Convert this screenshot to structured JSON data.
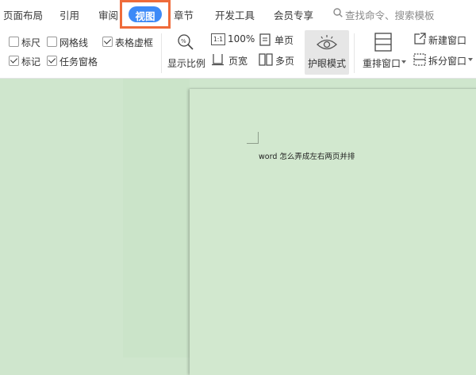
{
  "tabs": [
    {
      "label": "页面布局"
    },
    {
      "label": "引用"
    },
    {
      "label": "审阅"
    },
    {
      "label": "视图",
      "active": true
    },
    {
      "label": "章节"
    },
    {
      "label": "开发工具"
    },
    {
      "label": "会员专享"
    }
  ],
  "search": {
    "placeholder": "查找命令、搜索模板"
  },
  "checkboxes": [
    {
      "label": "标尺",
      "checked": false
    },
    {
      "label": "网格线",
      "checked": false
    },
    {
      "label": "表格虚框",
      "checked": true
    },
    {
      "label": "标记",
      "checked": true
    },
    {
      "label": "任务窗格",
      "checked": true
    }
  ],
  "ribbon": {
    "zoom_label": "显示比例",
    "hundred_label": "100%",
    "pagewidth_label": "页宽",
    "single_label": "单页",
    "multi_label": "多页",
    "eye_label": "护眼模式",
    "arrange_label": "重排窗口",
    "newwin_label": "新建窗口",
    "split_label": "拆分窗口",
    "one_to_one": "1:1"
  },
  "document": {
    "text": "word 怎么弄成左右两页并排"
  },
  "colors": {
    "accent": "#3d8af7",
    "highlight": "#ef6b3a",
    "eye_bg": "#cfe6cd"
  }
}
